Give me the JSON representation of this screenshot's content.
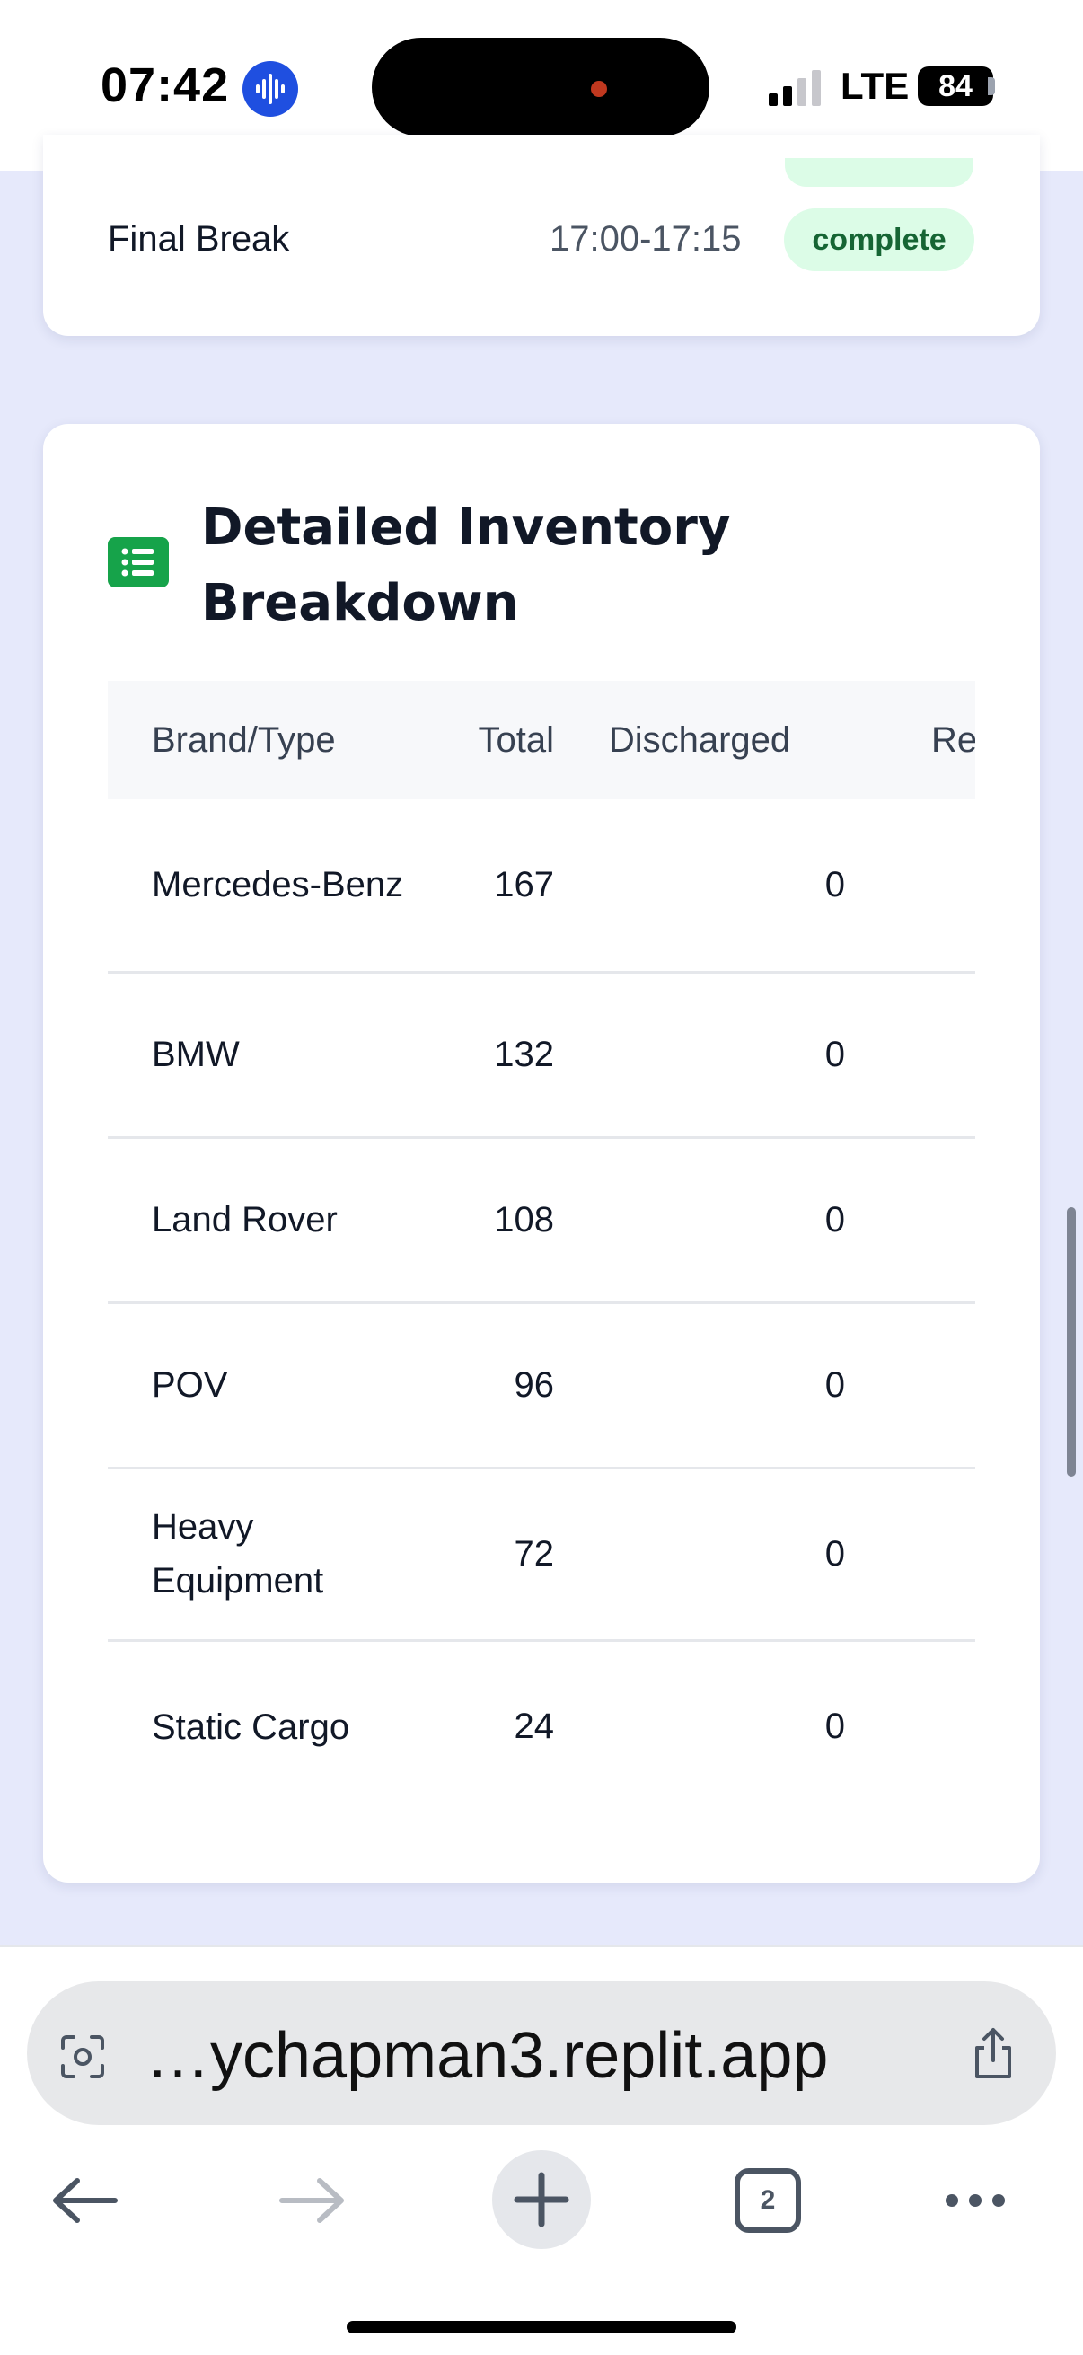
{
  "status_bar": {
    "time": "07:42",
    "network": "LTE",
    "battery": "84"
  },
  "schedule_card": {
    "row": {
      "label": "Final Break",
      "time_range": "17:00-17:15",
      "status": "complete"
    }
  },
  "inventory": {
    "title": "Detailed Inventory Breakdown",
    "columns": [
      "Brand/Type",
      "Total",
      "Discharged",
      "Rer"
    ],
    "rows": [
      {
        "brand": "Mercedes-Benz",
        "total": "167",
        "discharged": "0"
      },
      {
        "brand": "BMW",
        "total": "132",
        "discharged": "0"
      },
      {
        "brand": "Land Rover",
        "total": "108",
        "discharged": "0"
      },
      {
        "brand": "POV",
        "total": "96",
        "discharged": "0"
      },
      {
        "brand": "Heavy Equipment",
        "total": "72",
        "discharged": "0"
      },
      {
        "brand": "Static Cargo",
        "total": "24",
        "discharged": "0"
      }
    ]
  },
  "browser": {
    "url": "…ychapman3.replit.app",
    "tab_count": "2"
  },
  "icons": [
    "siri-icon",
    "signal-icon",
    "battery-icon",
    "list-icon",
    "page-scan-icon",
    "share-icon",
    "back-arrow-icon",
    "forward-arrow-icon",
    "new-tab-plus-icon",
    "tabs-icon",
    "more-icon"
  ],
  "colors": {
    "background": "#e6e9fb",
    "status_complete_bg": "#dcfce7",
    "status_complete_text": "#166534",
    "accent_green": "#16a34a"
  }
}
